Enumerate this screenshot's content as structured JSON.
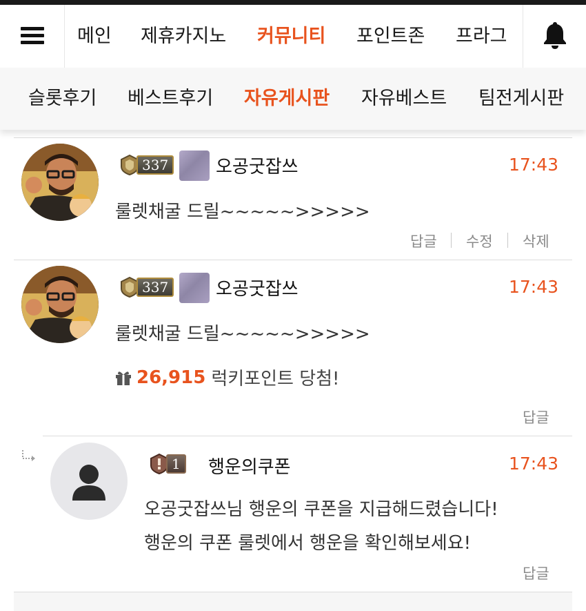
{
  "nav": {
    "menu": [
      "메인",
      "제휴카지노",
      "커뮤니티",
      "포인트존",
      "프라그"
    ],
    "active_index": 2,
    "hamburger_icon": "hamburger-menu-icon",
    "bell_icon": "bell-icon"
  },
  "subnav": {
    "items": [
      "슬롯후기",
      "베스트후기",
      "자유게시판",
      "자유베스트",
      "팀전게시판"
    ],
    "active_index": 2
  },
  "comments": [
    {
      "level": "337",
      "nickname": "오공굿잡쓰",
      "time": "17:43",
      "text": "룰렛채굴 드릴~~~~~>>>>>",
      "actions": [
        "답글",
        "수정",
        "삭제"
      ]
    },
    {
      "level": "337",
      "nickname": "오공굿잡쓰",
      "time": "17:43",
      "text": "룰렛채굴 드릴~~~~~>>>>>",
      "lucky_amount": "26,915",
      "lucky_text": "럭키포인트 당첨!",
      "actions": [
        "답글"
      ]
    },
    {
      "level": "1",
      "nickname": "행운의쿠폰",
      "time": "17:43",
      "text_lines": [
        "오공굿잡쓰님 행운의 쿠폰을 지급해드렸습니다!",
        "행운의 쿠폰 룰렛에서 행운을 확인해보세요!"
      ],
      "actions": [
        "답글"
      ]
    }
  ],
  "colors": {
    "accent": "#e8531e",
    "text": "#222222",
    "muted": "#8a8a8a"
  }
}
